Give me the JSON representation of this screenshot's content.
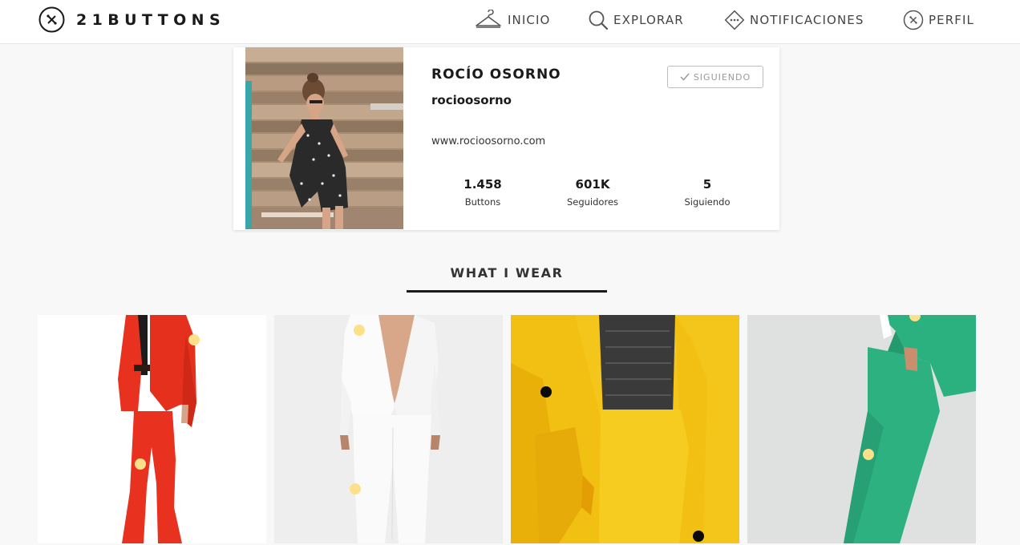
{
  "app": {
    "logo_text": "21BUTTONS"
  },
  "nav": {
    "inicio": "INICIO",
    "explorar": "EXPLORAR",
    "notificaciones": "NOTIFICACIONES",
    "perfil": "PERFIL"
  },
  "profile": {
    "name": "ROCÍO OSORNO",
    "username": "rocioosorno",
    "website": "www.rocioosorno.com",
    "follow_button": "SIGUIENDO",
    "stats": [
      {
        "value": "1.458",
        "label": "Buttons"
      },
      {
        "value": "601K",
        "label": "Seguidores"
      },
      {
        "value": "5",
        "label": "Siguiendo"
      }
    ]
  },
  "section": {
    "active_tab": "WHAT I WEAR"
  },
  "colors": {
    "accent": "#1a1a1a",
    "tag_dot_light": "#fde18a",
    "tag_dot_dark": "#0a0a0a",
    "red_suit": "#e8321f",
    "white_suit": "#f7f7f7",
    "yellow_suit": "#f4c51a",
    "green_suit": "#2bb07f"
  },
  "icons": {
    "logo": "21buttons-logo-icon",
    "inicio": "hanger-icon",
    "explorar": "search-icon",
    "notificaciones": "notification-diamond-icon",
    "perfil": "profile-button-icon",
    "follow": "check-icon"
  }
}
